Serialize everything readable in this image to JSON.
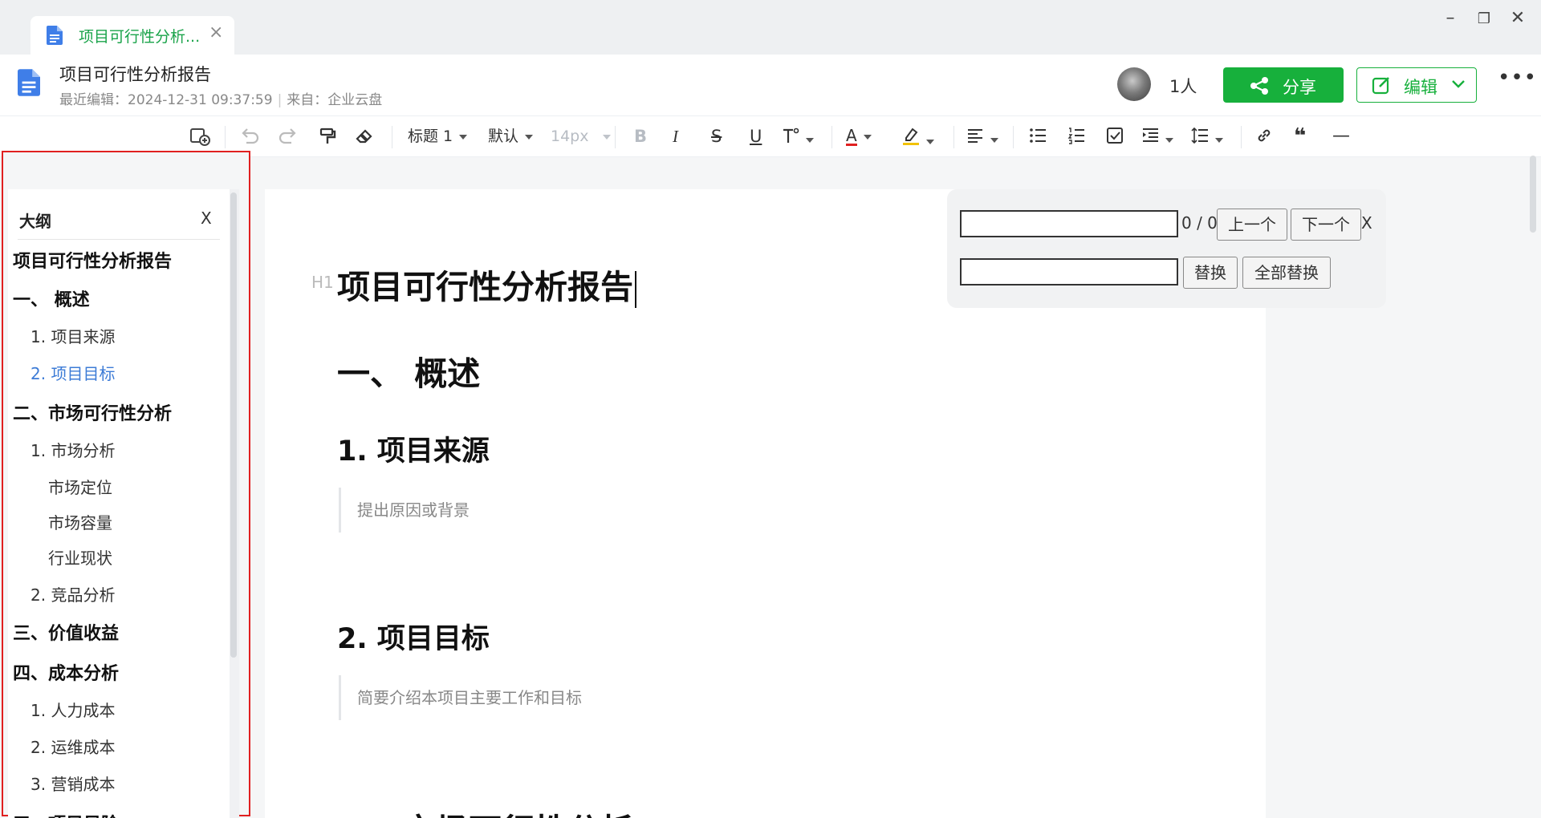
{
  "tab": {
    "title": "项目可行性分析...",
    "close": "×"
  },
  "window": {
    "minimize": "–",
    "restore": "❐",
    "close": "✕"
  },
  "header": {
    "title": "项目可行性分析报告",
    "last_edit": "最近编辑：2024-12-31 09:37:59",
    "source": "来自：企业云盘",
    "people": "1人",
    "share_label": "分享",
    "edit_label": "编辑",
    "more": "•••"
  },
  "toolbar": {
    "heading_style": "标题 1",
    "font_family": "默认",
    "font_size": "14px",
    "bold": "B",
    "italic": "I",
    "strike": "S",
    "underline": "U",
    "font_color": "A",
    "quote": "❝",
    "divider": "—"
  },
  "outline": {
    "title": "大纲",
    "close": "X",
    "items": [
      {
        "label": "项目可行性分析报告",
        "level": 1
      },
      {
        "label": "一、 概述",
        "level": 1
      },
      {
        "label": "1. 项目来源",
        "level": 2
      },
      {
        "label": "2. 项目目标",
        "level": 2
      },
      {
        "label": "二、市场可行性分析",
        "level": 1
      },
      {
        "label": "1. 市场分析",
        "level": 2
      },
      {
        "label": "市场定位",
        "level": 3
      },
      {
        "label": "市场容量",
        "level": 3
      },
      {
        "label": "行业现状",
        "level": 3
      },
      {
        "label": "2. 竞品分析",
        "level": 2
      },
      {
        "label": "三、价值收益",
        "level": 1
      },
      {
        "label": "四、成本分析",
        "level": 1
      },
      {
        "label": "1. 人力成本",
        "level": 2
      },
      {
        "label": "2. 运维成本",
        "level": 2
      },
      {
        "label": "3. 营销成本",
        "level": 2
      },
      {
        "label": "五、项目风险",
        "level": 1
      }
    ]
  },
  "document": {
    "h_marker": "H1",
    "title": "项目可行性分析报告",
    "section1": "一、  概述",
    "sub1": "1. 项目来源",
    "sub1_hint": "提出原因或背景",
    "sub2": "2. 项目目标",
    "sub2_hint": "简要介绍本项目主要工作和目标",
    "section2": "二、市场可行性分析"
  },
  "find_replace": {
    "find_value": "",
    "replace_value": "",
    "count": "0 / 0",
    "prev": "上一个",
    "next": "下一个",
    "close": "X",
    "replace": "替换",
    "replace_all": "全部替换"
  },
  "colors": {
    "accent_green": "#17b03c",
    "tab_text_green": "#1aa34a",
    "highlight_frame_red": "#e02020",
    "outline_active_blue": "#3c7bd6"
  }
}
